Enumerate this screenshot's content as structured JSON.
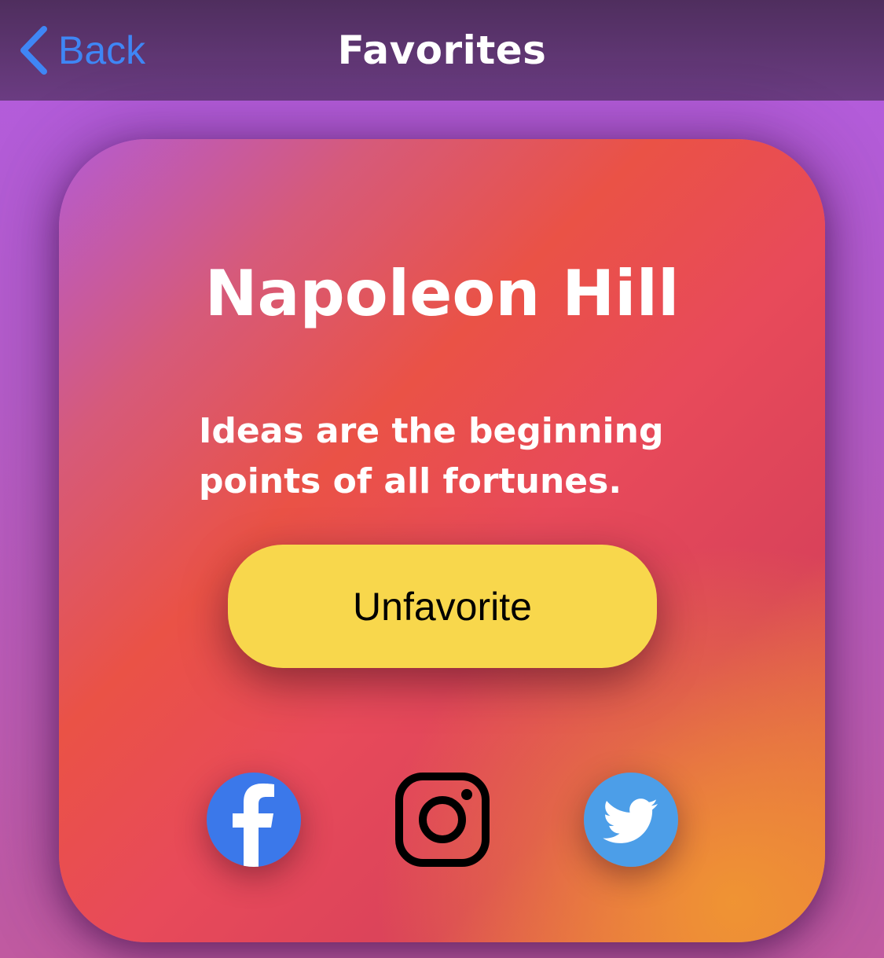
{
  "navbar": {
    "back_label": "Back",
    "title": "Favorites"
  },
  "card": {
    "author": "Napoleon Hill",
    "quote": "Ideas are the beginning points of all fortunes.",
    "unfavorite_label": "Unfavorite"
  },
  "social": {
    "icons": [
      "facebook-icon",
      "instagram-icon",
      "twitter-icon"
    ]
  },
  "colors": {
    "accent_back": "#3f86f5",
    "button_yellow": "#f8d74c",
    "facebook_blue": "#3b78ea",
    "twitter_blue": "#4c9ee8"
  }
}
